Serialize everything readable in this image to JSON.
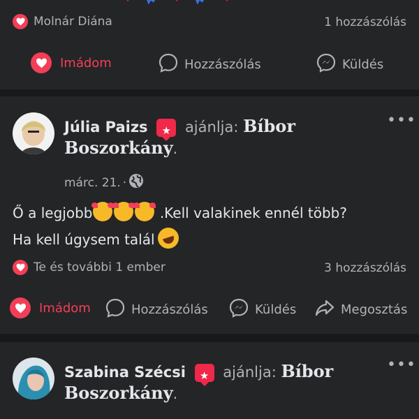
{
  "post1": {
    "reactor_name": "Molnár Diána",
    "comments": "1 hozzászólás",
    "actions": {
      "like": "Imádom",
      "comment": "Hozzászólás",
      "send": "Küldés"
    }
  },
  "post2": {
    "author": "Júlia Paizs",
    "recommends": "ajánlja:",
    "page": "Bíbor Boszorkány",
    "period": ".",
    "date": "márc. 21.",
    "date_sep": "·",
    "text_line1_a": "Ő a legjobb",
    "text_line1_b": ".Kell valakinek ennél több?",
    "text_line2": "Ha kell úgysem talál",
    "reactions": "Te és további 1 ember",
    "comments": "3 hozzászólás",
    "actions": {
      "like": "Imádom",
      "comment": "Hozzászólás",
      "send": "Küldés",
      "share": "Megosztás"
    }
  },
  "post3": {
    "author": "Szabina Szécsi",
    "recommends": "ajánlja:",
    "page": "Bíbor Boszorkány",
    "period": "."
  },
  "colors": {
    "background": "#18191a",
    "card": "#242526",
    "accent_red": "#f33e58",
    "text": "#e4e6eb",
    "muted": "#b0b3b8"
  },
  "icons": [
    "heart-icon",
    "comment-icon",
    "messenger-icon",
    "share-icon",
    "globe-icon",
    "more-icon",
    "recommend-icon"
  ]
}
